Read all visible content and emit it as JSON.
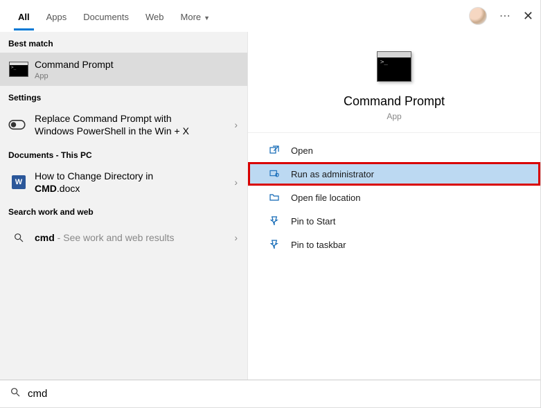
{
  "tabs": {
    "all": "All",
    "apps": "Apps",
    "documents": "Documents",
    "web": "Web",
    "more": "More"
  },
  "sections": {
    "best_match": "Best match",
    "settings": "Settings",
    "documents": "Documents - This PC",
    "search_web": "Search work and web"
  },
  "best": {
    "title": "Command Prompt",
    "sub": "App"
  },
  "setting": {
    "line1": "Replace Command Prompt with",
    "line2": "Windows PowerShell in the Win + X"
  },
  "doc": {
    "line1": "How to Change Directory in",
    "bold": "CMD",
    "ext": ".docx"
  },
  "webresult": {
    "bold": "cmd",
    "tail": " - See work and web results"
  },
  "preview": {
    "title": "Command Prompt",
    "sub": "App"
  },
  "actions": {
    "open": "Open",
    "admin": "Run as administrator",
    "location": "Open file location",
    "pin_start": "Pin to Start",
    "pin_taskbar": "Pin to taskbar"
  },
  "search": {
    "value": "cmd"
  }
}
